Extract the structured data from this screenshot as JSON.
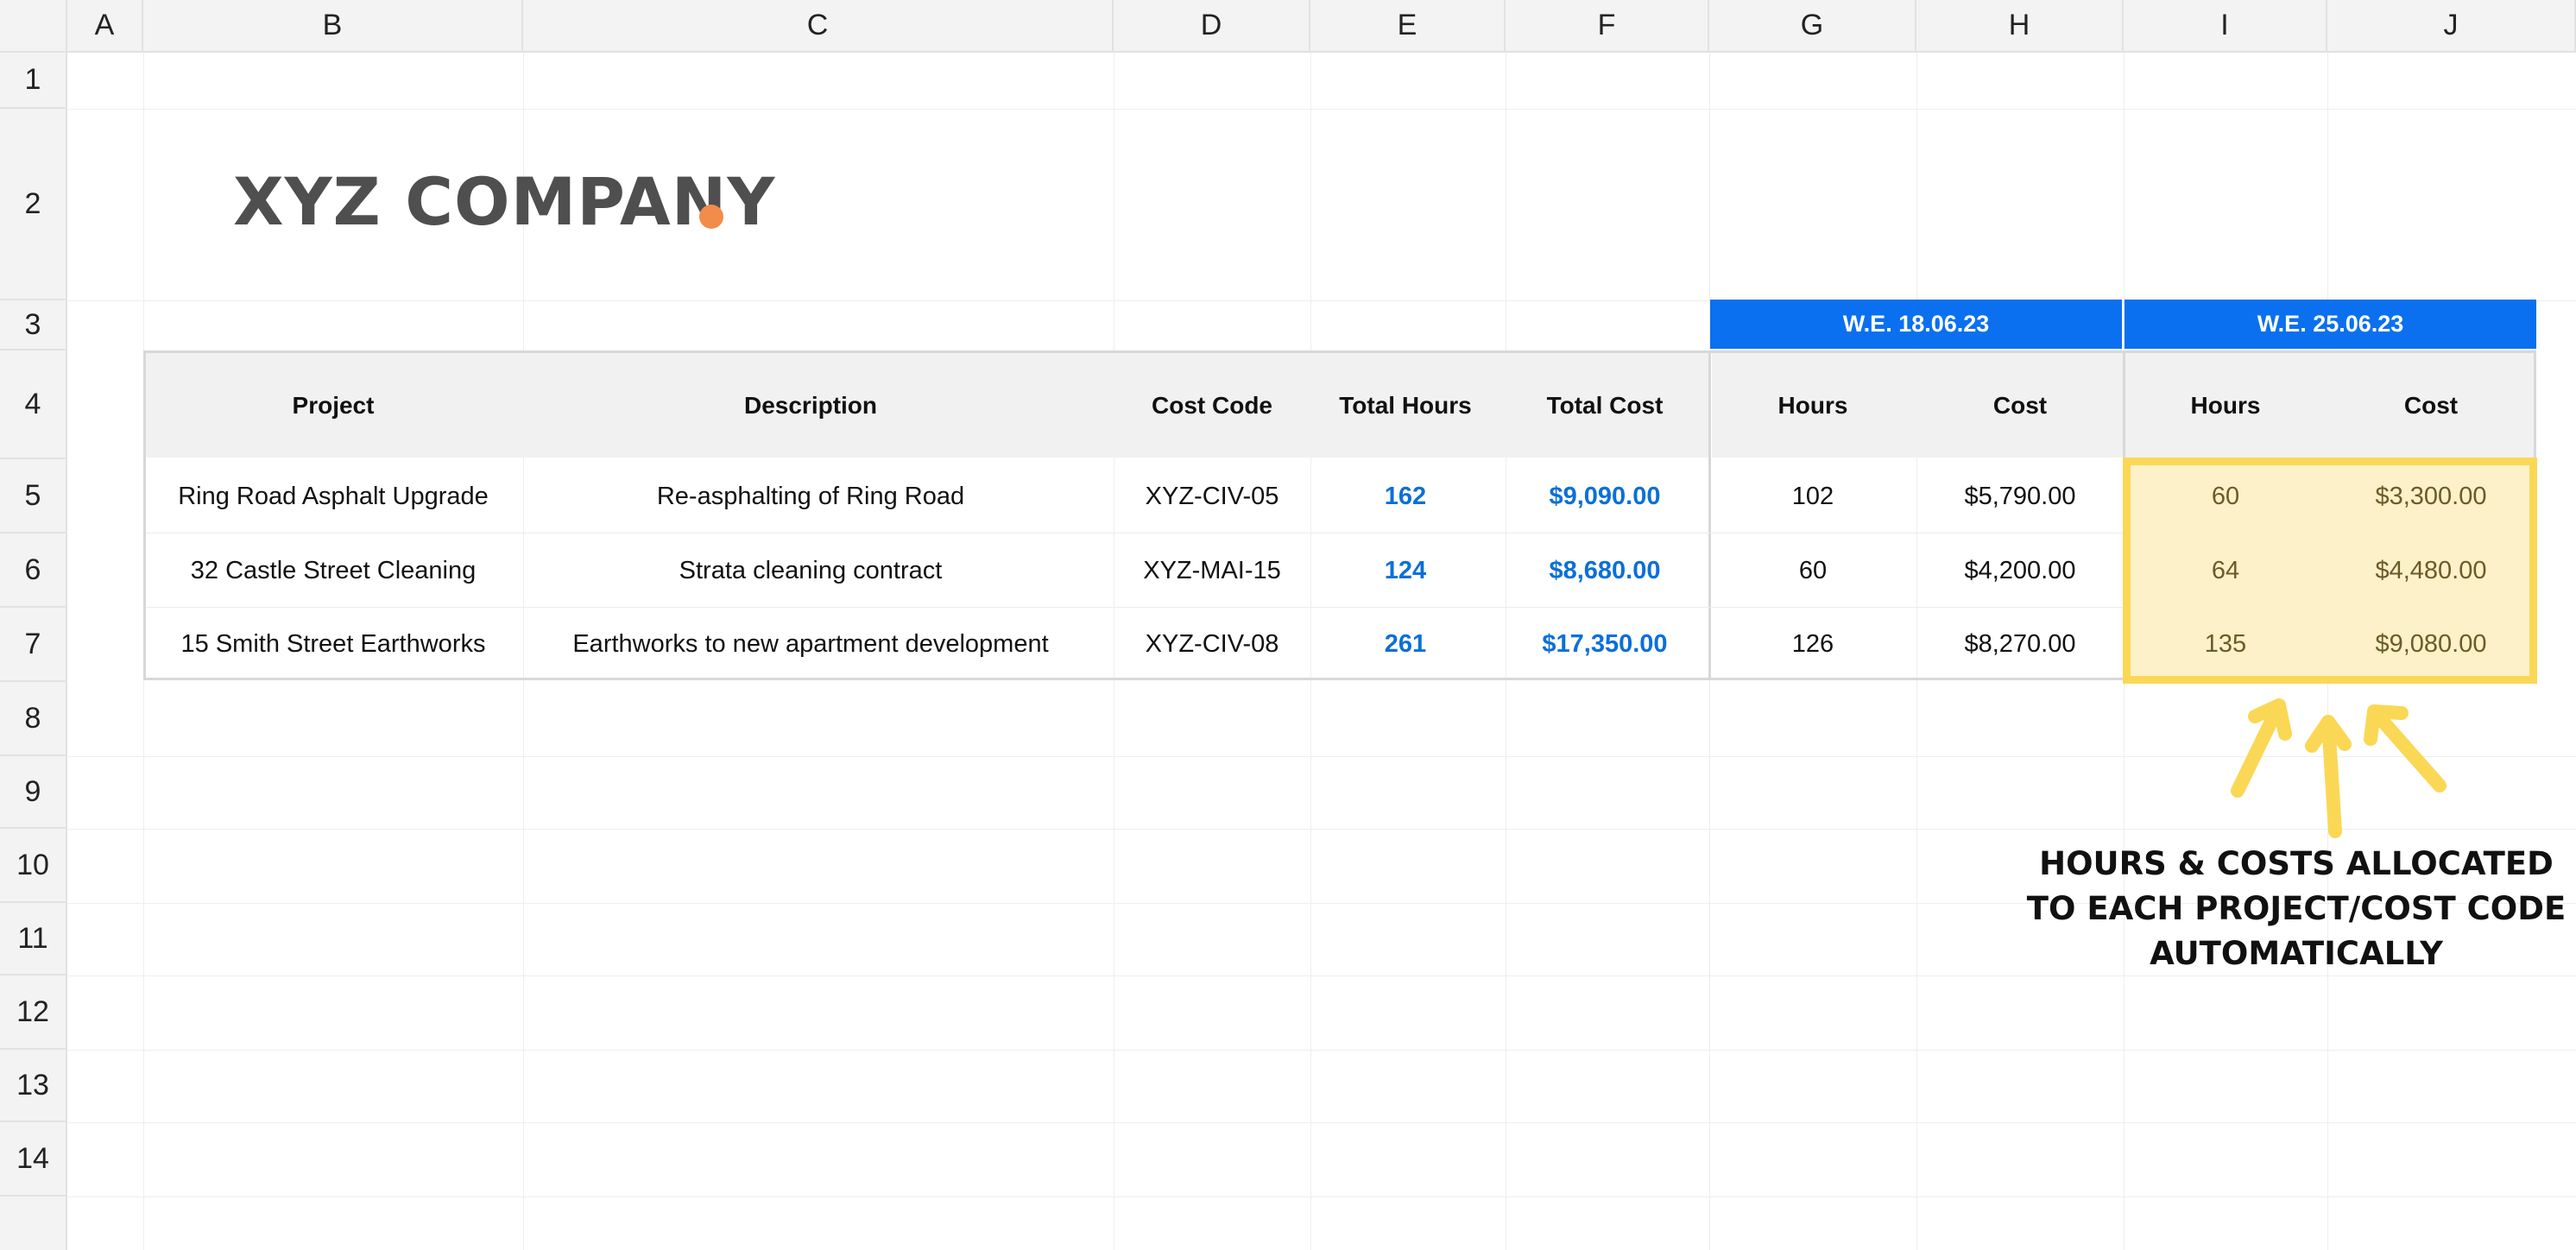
{
  "columns": [
    "A",
    "B",
    "C",
    "D",
    "E",
    "F",
    "G",
    "H",
    "I",
    "J"
  ],
  "rows": [
    "1",
    "2",
    "3",
    "4",
    "5",
    "6",
    "7",
    "8",
    "9",
    "10",
    "11",
    "12",
    "13",
    "14"
  ],
  "logo": {
    "text": "XYZ COMPANY",
    "dot_color": "#f28c4a"
  },
  "weeks": [
    {
      "label": "W.E. 18.06.23"
    },
    {
      "label": "W.E. 25.06.23"
    }
  ],
  "headers": {
    "project": "Project",
    "description": "Description",
    "cost_code": "Cost Code",
    "total_hours": "Total Hours",
    "total_cost": "Total Cost",
    "w1_hours": "Hours",
    "w1_cost": "Cost",
    "w2_hours": "Hours",
    "w2_cost": "Cost"
  },
  "table": [
    {
      "project": "Ring Road Asphalt Upgrade",
      "description": "Re-asphalting of Ring Road",
      "cost_code": "XYZ-CIV-05",
      "total_hours": "162",
      "total_cost": "$9,090.00",
      "w1_hours": "102",
      "w1_cost": "$5,790.00",
      "w2_hours": "60",
      "w2_cost": "$3,300.00"
    },
    {
      "project": "32 Castle Street Cleaning",
      "description": "Strata cleaning contract",
      "cost_code": "XYZ-MAI-15",
      "total_hours": "124",
      "total_cost": "$8,680.00",
      "w1_hours": "60",
      "w1_cost": "$4,200.00",
      "w2_hours": "64",
      "w2_cost": "$4,480.00"
    },
    {
      "project": "15 Smith Street Earthworks",
      "description": "Earthworks to new apartment development",
      "cost_code": "XYZ-CIV-08",
      "total_hours": "261",
      "total_cost": "$17,350.00",
      "w1_hours": "126",
      "w1_cost": "$8,270.00",
      "w2_hours": "135",
      "w2_cost": "$9,080.00"
    }
  ],
  "annotation": {
    "line1": "HOURS & COSTS ALLOCATED",
    "line2": "TO EACH PROJECT/COST CODE",
    "line3": "AUTOMATICALLY"
  },
  "colors": {
    "accent_blue": "#0a70f0",
    "value_blue": "#0b6fd9",
    "highlight_yellow": "#fad855",
    "highlight_fill": "#fcf1c8",
    "logo_gray": "#4f4f4f"
  }
}
